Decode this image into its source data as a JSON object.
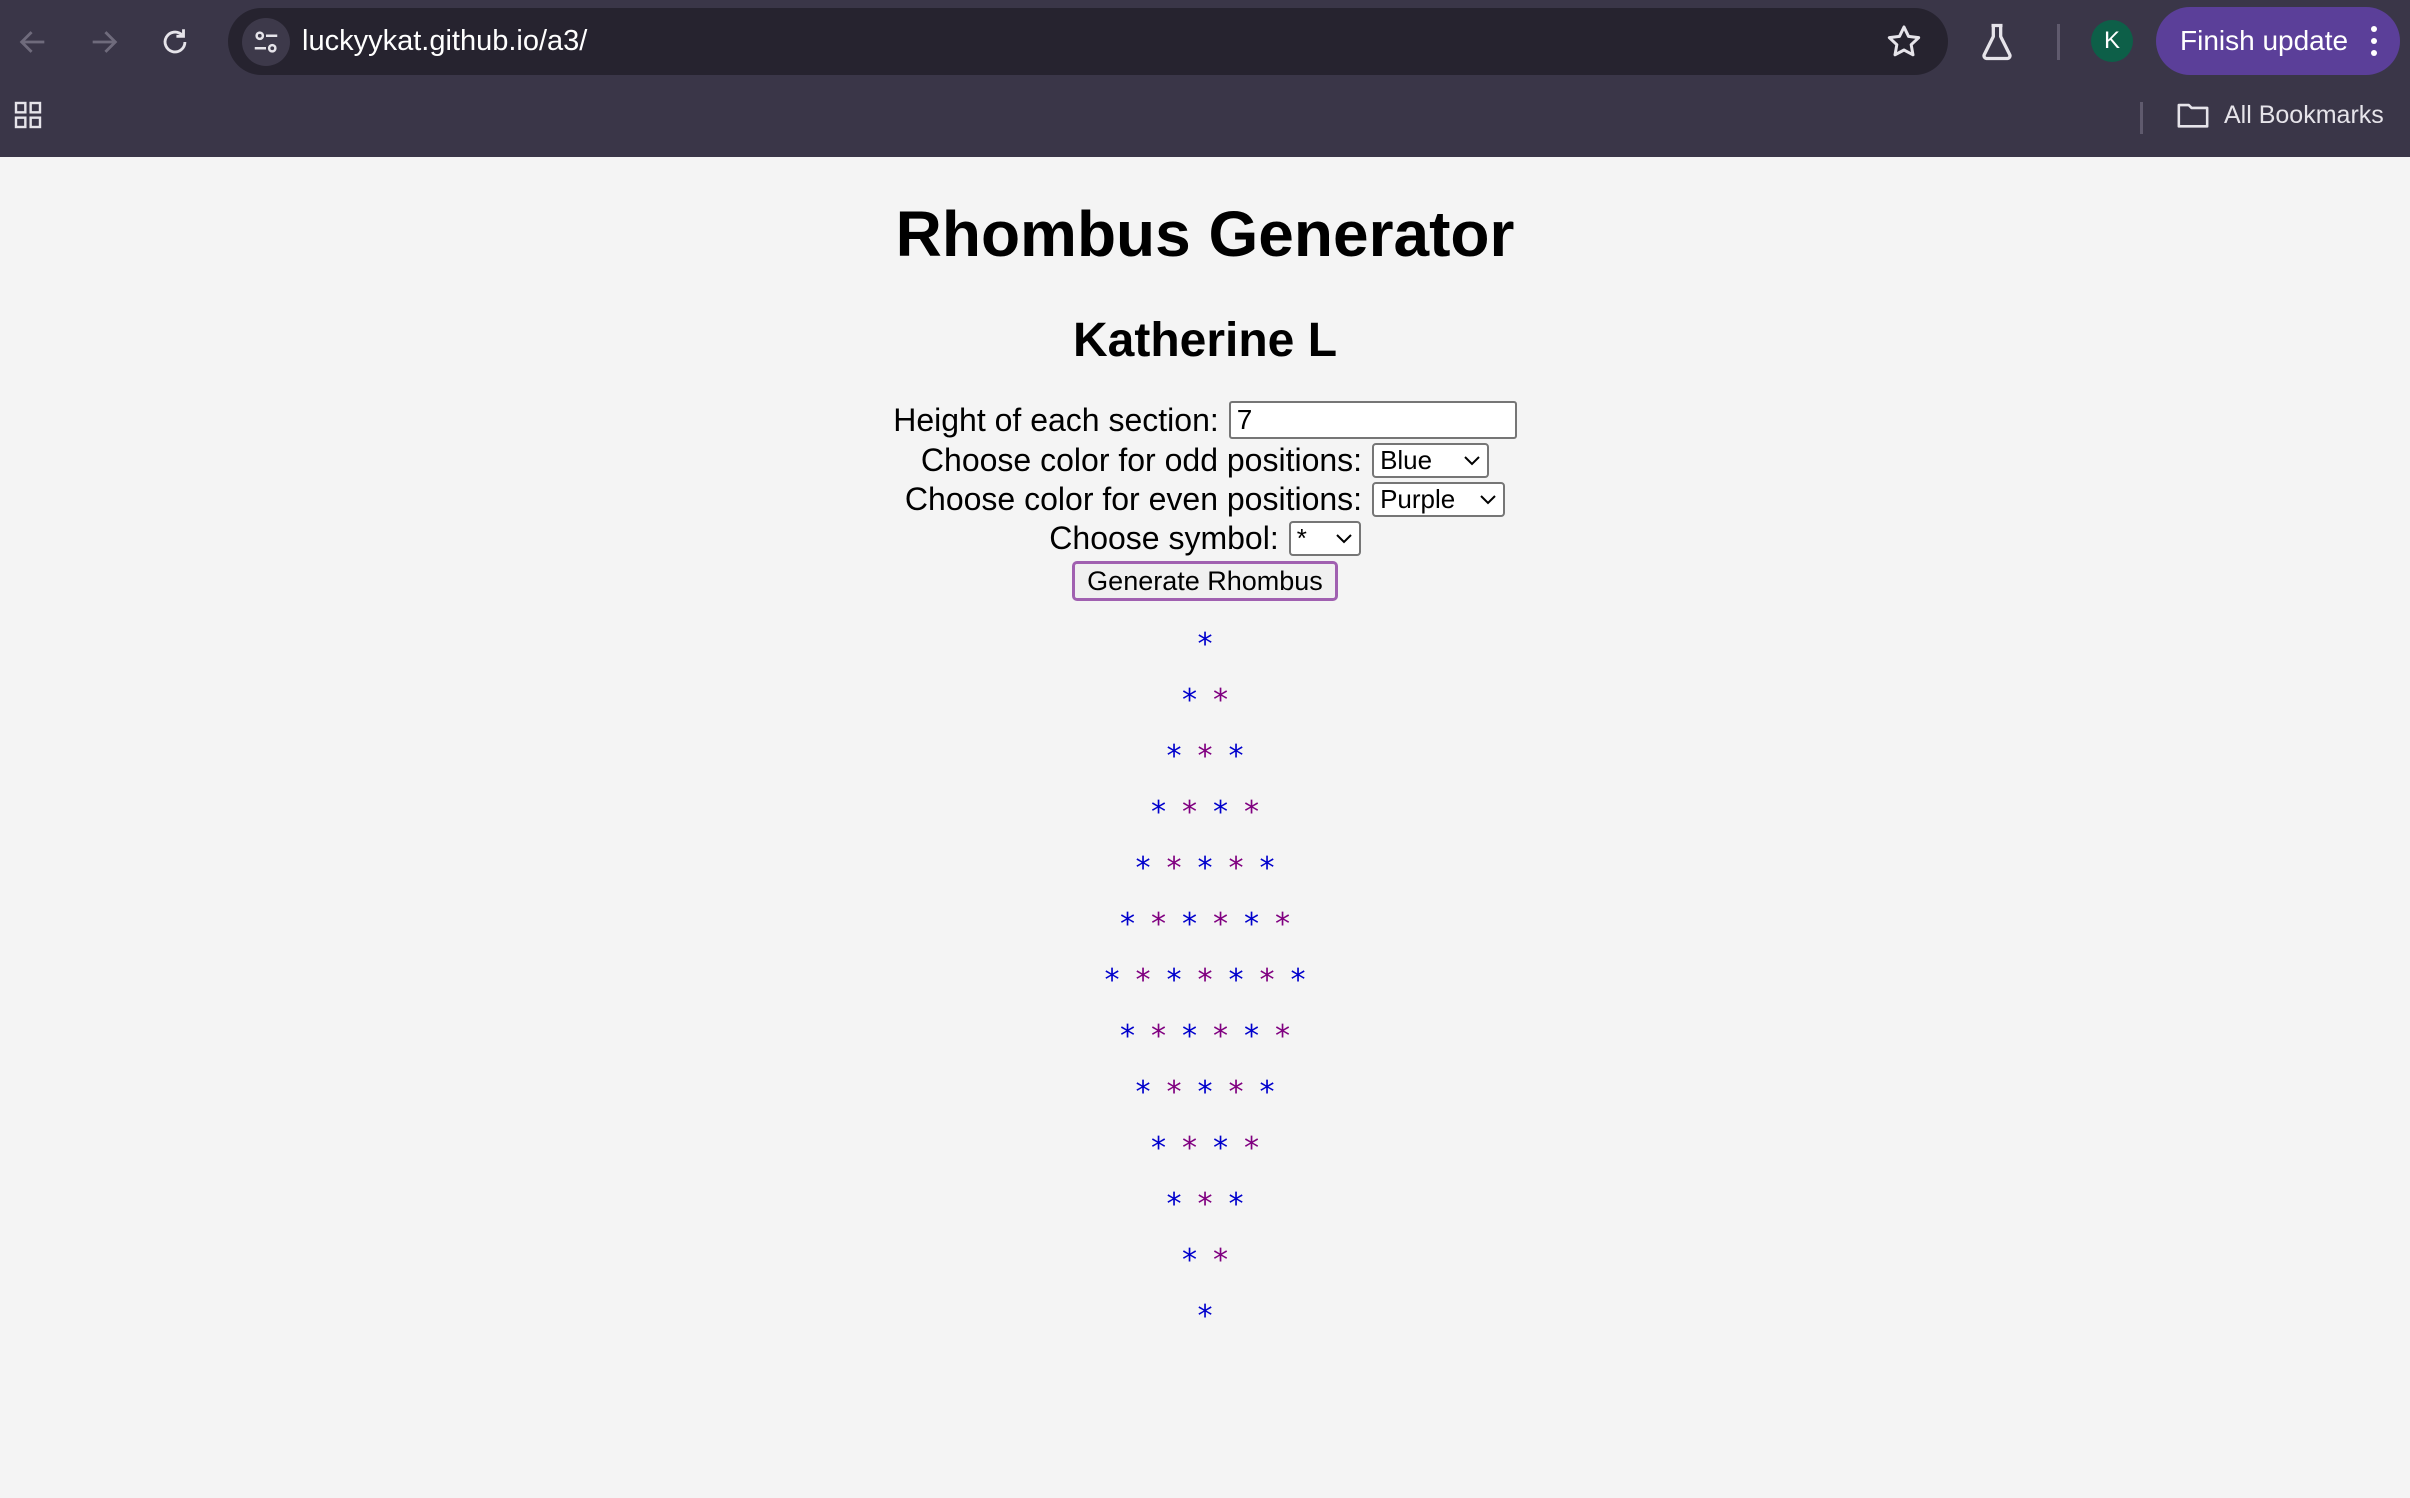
{
  "browser": {
    "url": "luckyykat.github.io/a3/",
    "avatar_letter": "K",
    "update_button": "Finish update",
    "bookmarks_label": "All Bookmarks"
  },
  "page": {
    "title": "Rhombus Generator",
    "author": "Katherine L",
    "height_label": "Height of each section:",
    "height_value": "7",
    "odd_label": "Choose color for odd positions:",
    "odd_value": "Blue",
    "even_label": "Choose color for even positions:",
    "even_value": "Purple",
    "symbol_label": "Choose symbol:",
    "symbol_value": "*",
    "generate_button": "Generate Rhombus"
  },
  "rhombus": {
    "height": 7,
    "symbol": "*",
    "odd_color": "#0000cc",
    "even_color": "#800080"
  }
}
